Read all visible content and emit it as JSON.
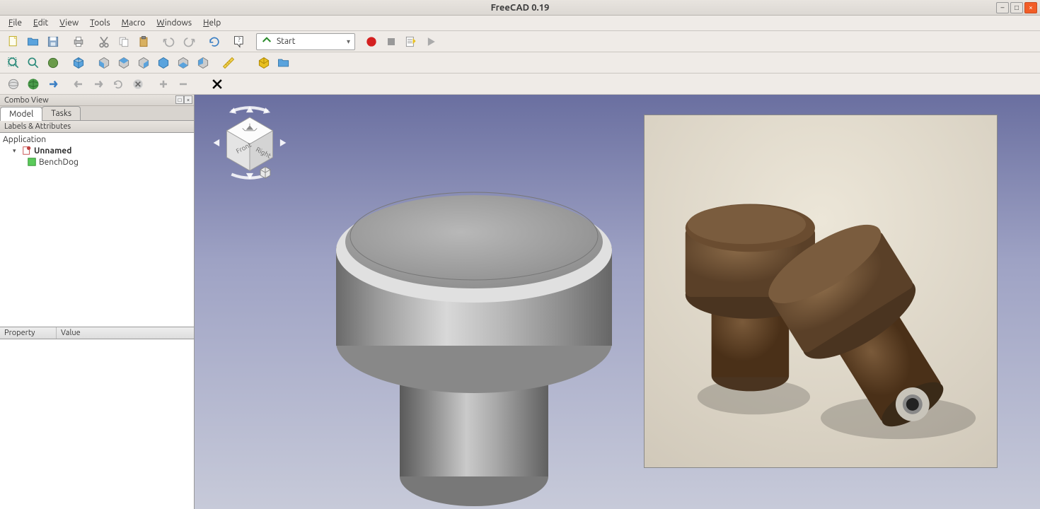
{
  "window": {
    "title": "FreeCAD 0.19"
  },
  "menu": {
    "file": "File",
    "edit": "Edit",
    "view": "View",
    "tools": "Tools",
    "macro": "Macro",
    "windows": "Windows",
    "help": "Help"
  },
  "workbench": {
    "selected": "Start"
  },
  "comboview": {
    "title": "Combo View",
    "tabs": {
      "model": "Model",
      "tasks": "Tasks"
    },
    "labels_header": "Labels & Attributes",
    "application": "Application",
    "doc_name": "Unnamed",
    "item1": "BenchDog",
    "prop_header": {
      "property": "Property",
      "value": "Value"
    }
  },
  "navcube": {
    "front": "Front",
    "right": "Right"
  },
  "colors": {
    "accent": "#3b7fc4",
    "macro_record": "#d42020"
  }
}
